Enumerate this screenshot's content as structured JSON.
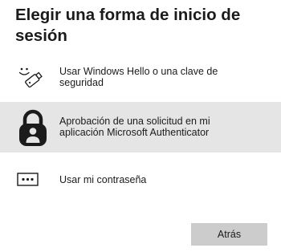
{
  "dialog": {
    "title": "Elegir una forma de inicio de sesión"
  },
  "options": [
    {
      "label": "Usar Windows Hello o una clave de seguridad",
      "icon": "windows-hello-key-icon",
      "selected": false
    },
    {
      "label": "Aprobación de una solicitud en mi aplicación Microsoft Authenticator",
      "icon": "authenticator-lock-icon",
      "selected": true
    },
    {
      "label": "Usar mi contraseña",
      "icon": "password-dots-icon",
      "selected": false
    }
  ],
  "buttons": {
    "back_label": "Atrás"
  },
  "colors": {
    "selected_background": "#e5e5e5",
    "button_background": "#cccccc",
    "text": "#1b1b1b"
  }
}
